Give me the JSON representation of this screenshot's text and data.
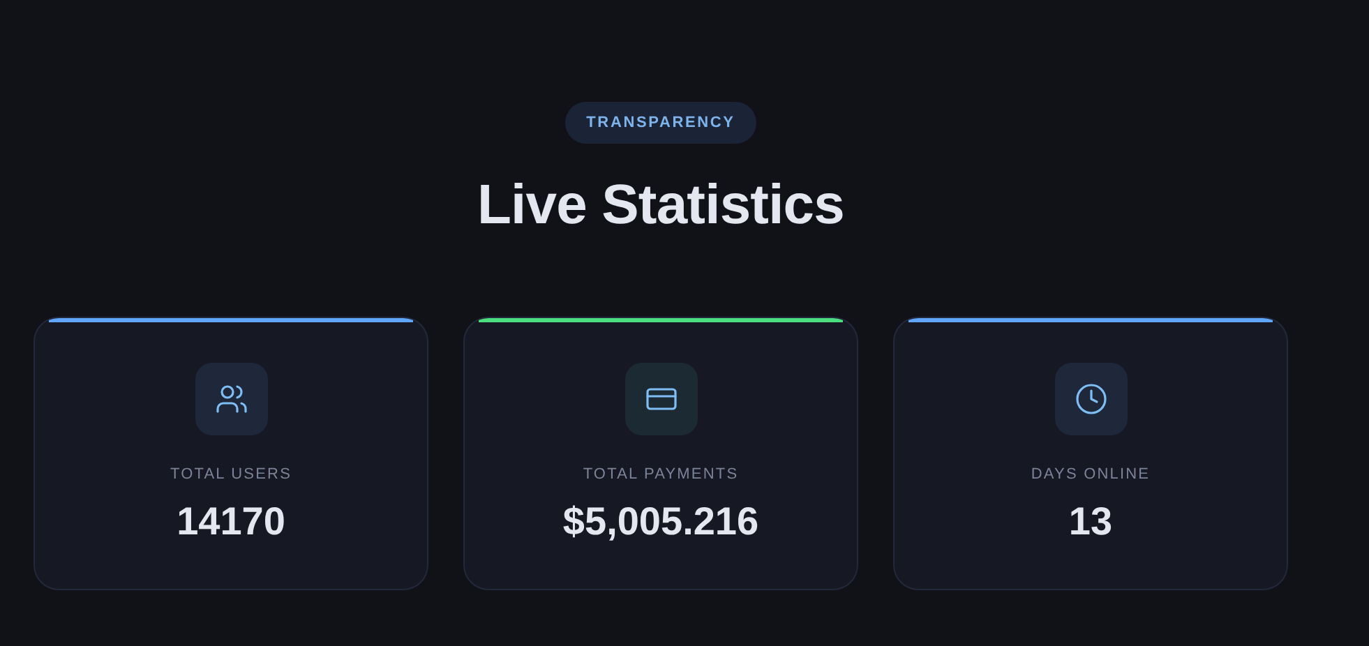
{
  "badge": "TRANSPARENCY",
  "title": "Live Statistics",
  "stats": [
    {
      "kind": "users",
      "label": "TOTAL USERS",
      "value": "14170",
      "color": "#60a5fa"
    },
    {
      "kind": "payments",
      "label": "TOTAL PAYMENTS",
      "value": "$5,005.216",
      "color": "#4ade80"
    },
    {
      "kind": "clock",
      "label": "DAYS ONLINE",
      "value": "13",
      "color": "#60a5fa"
    }
  ]
}
